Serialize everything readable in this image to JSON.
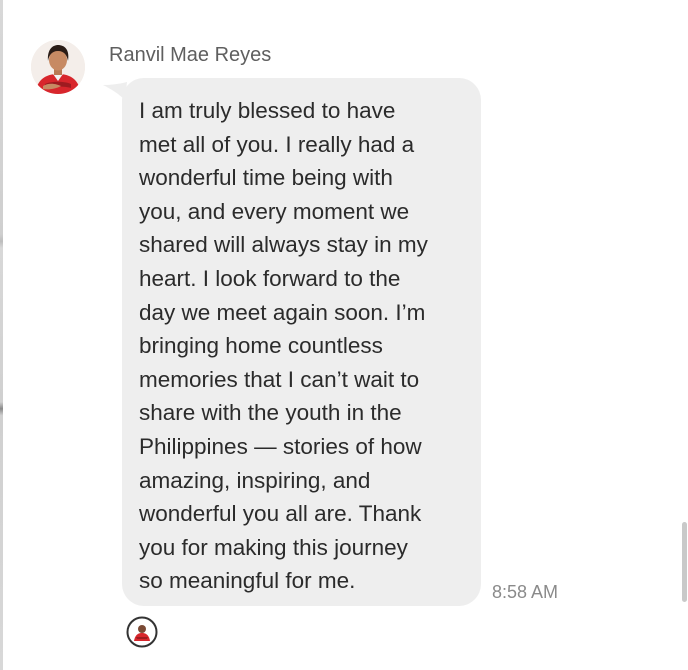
{
  "message": {
    "sender_name": "Ranvil Mae Reyes",
    "text": "I am truly blessed to have\nmet all of you. I really had a\nwonderful time being with\nyou, and every moment we\nshared will always stay in my\nheart. I look forward to the\nday we meet again soon. I’m\nbringing home countless\nmemories that I can’t wait to\nshare with the youth in the\nPhilippines — stories of how\namazing, inspiring, and\nwonderful you all are. Thank\nyou for making this journey\nso meaningful for me.",
    "timestamp": "8:58 AM",
    "avatar": "profile-photo",
    "reaction_icon": "seen-by-avatar-icon"
  },
  "colors": {
    "bubble_bg": "#eeeeee",
    "text": "#2b2b2b",
    "sender_name": "#5f5f5f",
    "timestamp": "#8a8a8a",
    "avatar_shirt": "#d8262c"
  }
}
